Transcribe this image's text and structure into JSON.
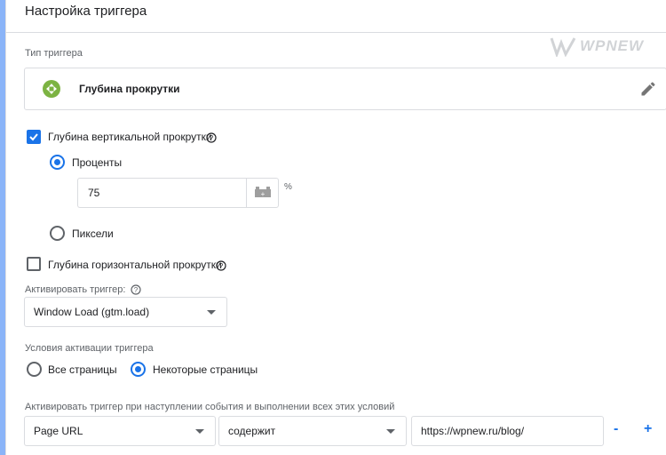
{
  "header": {
    "title": "Настройка триггера"
  },
  "watermark": {
    "text": "WPNEW"
  },
  "trigger_type": {
    "label": "Тип триггера",
    "name": "Глубина прокрутки",
    "icon": "scroll-depth-icon",
    "icon_color": "#7cb342"
  },
  "vertical": {
    "label": "Глубина вертикальной прокрутки",
    "checked": true,
    "options": {
      "percent_label": "Проценты",
      "percent_value": "75",
      "percent_unit": "%",
      "pixels_label": "Пиксели"
    }
  },
  "horizontal": {
    "label": "Глубина горизонтальной прокрутки",
    "checked": false
  },
  "activate": {
    "label": "Активировать триггер:",
    "selected": "Window Load (gtm.load)"
  },
  "conditions": {
    "label": "Условия активации триггера",
    "all_pages": "Все страницы",
    "some_pages": "Некоторые страницы",
    "selected": "some_pages"
  },
  "filter": {
    "label": "Активировать триггер при наступлении события и выполнении всех этих условий",
    "variable": "Page URL",
    "operator": "содержит",
    "value": "https://wpnew.ru/blog/",
    "minus": "-",
    "plus": "+"
  },
  "colors": {
    "accent": "#1a73e8",
    "strip": "#8ab4f8"
  }
}
